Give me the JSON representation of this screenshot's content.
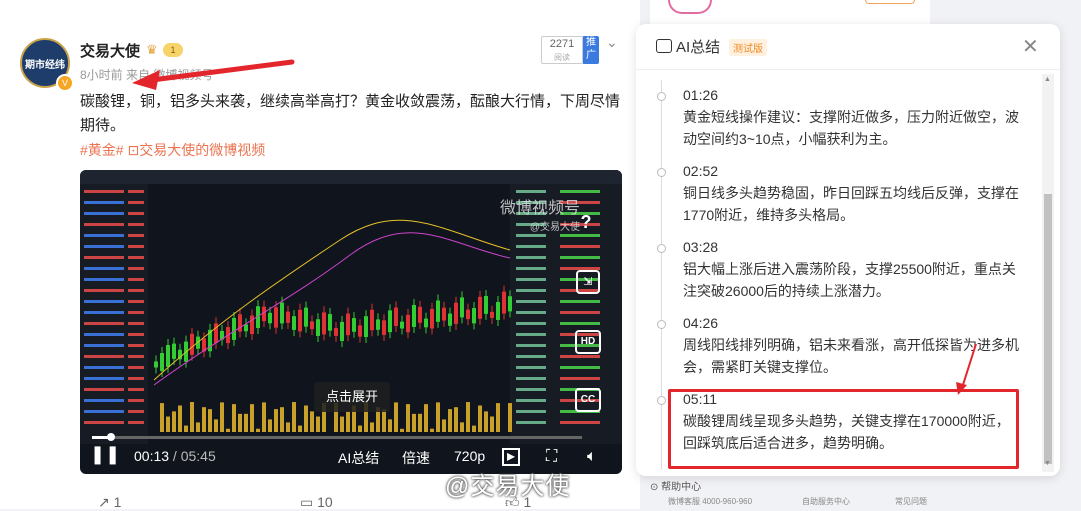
{
  "post": {
    "username": "交易大使",
    "level": "1",
    "avatar_text": "期市经纬",
    "meta": "8小时前 来自 微博视频号",
    "read_count": "2271",
    "read_label": "阅读",
    "push_label": "推广",
    "text": "碳酸锂，铜，铝多头来袭，继续高举高打？黄金收敛震荡，酝酿大行情，下周尽情期待。",
    "tags": "#黄金#  ⊡交易大使的微博视频",
    "actions": {
      "share": "1",
      "comment": "10",
      "like": "1"
    }
  },
  "video": {
    "watermark": "微博视频号",
    "watermark_sub": "@交易大使",
    "expand_label": "点击展开",
    "current_time": "00:13",
    "duration": "05:45",
    "time_sep": " / ",
    "ai_label": "AI总结",
    "speed_label": "倍速",
    "quality_label": "720p",
    "hd_label": "HD",
    "cc_label": "CC",
    "progress": 0.038,
    "overlay_watermark": "@交易大使"
  },
  "ai_panel": {
    "title": "AI总结",
    "badge": "测试版",
    "items": [
      {
        "time": "01:26",
        "text": "黄金短线操作建议：支撑附近做多，压力附近做空，波动空间约3~10点，小幅获利为主。"
      },
      {
        "time": "02:52",
        "text": "铜日线多头趋势稳固，昨日回踩五均线后反弹，支撑在1770附近，维持多头格局。"
      },
      {
        "time": "03:28",
        "text": "铝大幅上涨后进入震荡阶段，支撑25500附近，重点关注突破26000后的持续上涨潜力。"
      },
      {
        "time": "04:26",
        "text": "周线阳线排列明确，铝未来看涨，高开低探皆为进多机会，需紧盯关键支撑位。"
      },
      {
        "time": "05:11",
        "text": "碳酸锂周线呈现多头趋势，关键支撑在170000附近，回踩筑底后适合进多，趋势明确。"
      }
    ]
  },
  "footer": {
    "help": "帮助中心",
    "hotline": "微博客服 4000-960-960",
    "self_service": "自助服务中心",
    "faq": "常见问题"
  },
  "colors": {
    "accent": "#eb7350",
    "highlight_box": "#e3252c",
    "push": "#3b7be0",
    "beta": "#f08a24"
  }
}
